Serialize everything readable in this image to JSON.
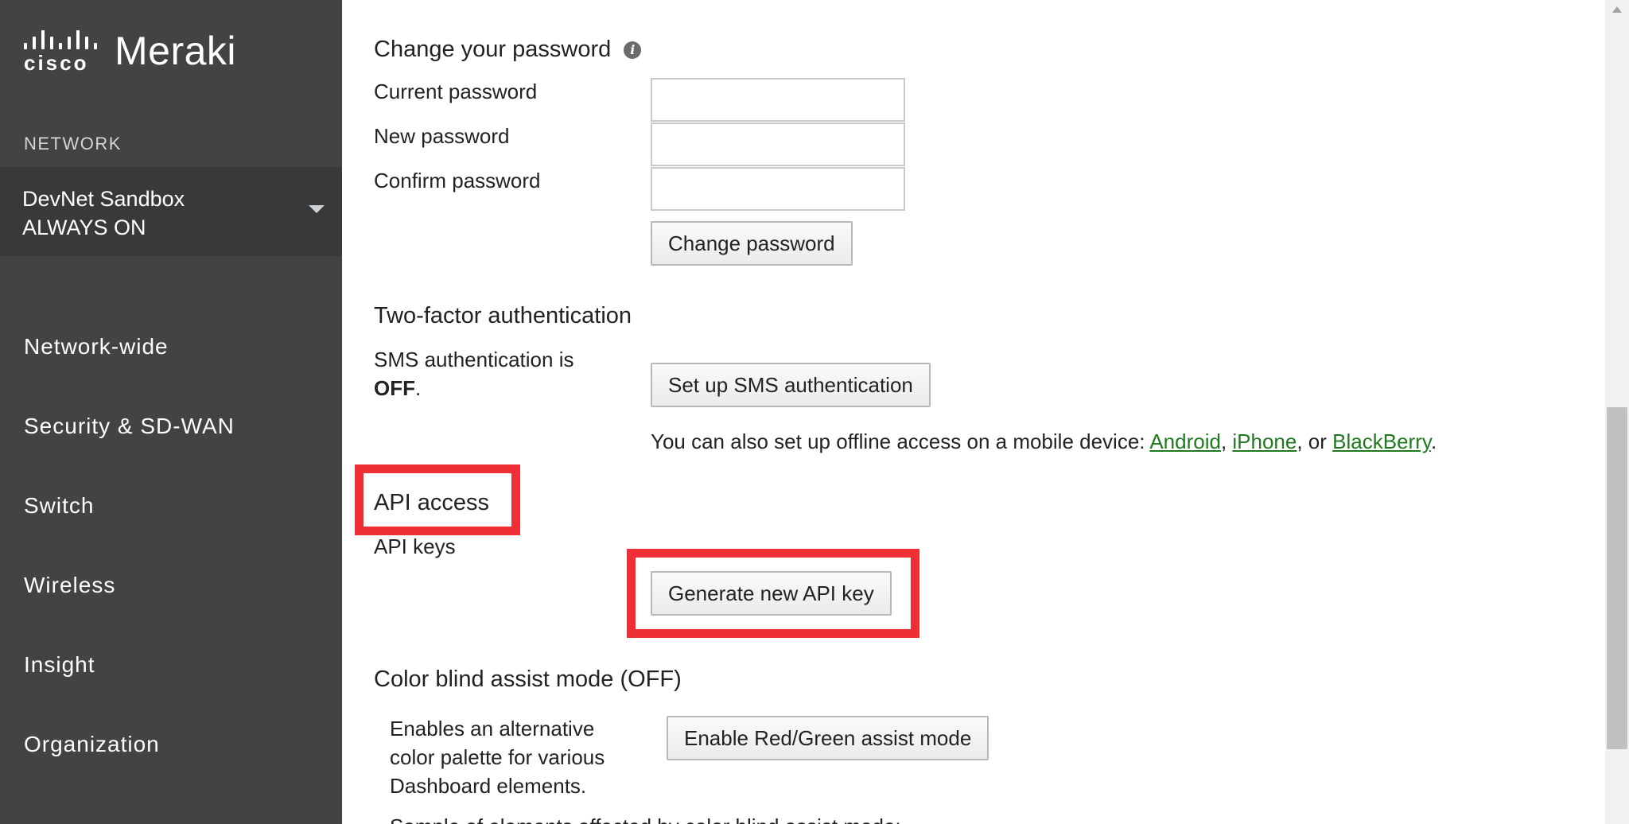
{
  "sidebar": {
    "brand_cisco": "cisco",
    "brand_product": "Meraki",
    "network_label": "NETWORK",
    "network_name_line1": "DevNet Sandbox",
    "network_name_line2": "ALWAYS ON",
    "nav_items": [
      "Network-wide",
      "Security & SD-WAN",
      "Switch",
      "Wireless",
      "Insight",
      "Organization"
    ]
  },
  "password": {
    "heading": "Change your password",
    "current_label": "Current password",
    "new_label": "New password",
    "confirm_label": "Confirm password",
    "current_value": "",
    "new_value": "",
    "confirm_value": "",
    "change_button": "Change password"
  },
  "two_factor": {
    "heading": "Two-factor authentication",
    "status_prefix": "SMS authentication is",
    "status_value": "OFF",
    "status_suffix": ".",
    "setup_button": "Set up SMS authentication",
    "offline_text": "You can also set up offline access on a mobile device: ",
    "link_android": "Android",
    "sep1": ", ",
    "link_iphone": "iPhone",
    "sep2": ", or ",
    "link_blackberry": "BlackBerry",
    "end": "."
  },
  "api": {
    "heading": "API access",
    "keys_label": "API keys",
    "generate_button": "Generate new API key"
  },
  "color_blind": {
    "heading": "Color blind assist mode (OFF)",
    "description_line1": "Enables an alternative",
    "description_line2": "color palette for various",
    "description_line3": "Dashboard elements.",
    "enable_button": "Enable Red/Green assist mode",
    "cut_off_text": "Sample of elements affected by color blind assist mode:"
  },
  "icons": {
    "info": "info-icon",
    "caret": "chevron-down-icon",
    "logo": "cisco-logo-icon"
  },
  "colors": {
    "sidebar_bg": "#414344",
    "network_bg": "#37393a",
    "link": "#1f7a1f",
    "highlight": "#ee2f35"
  }
}
